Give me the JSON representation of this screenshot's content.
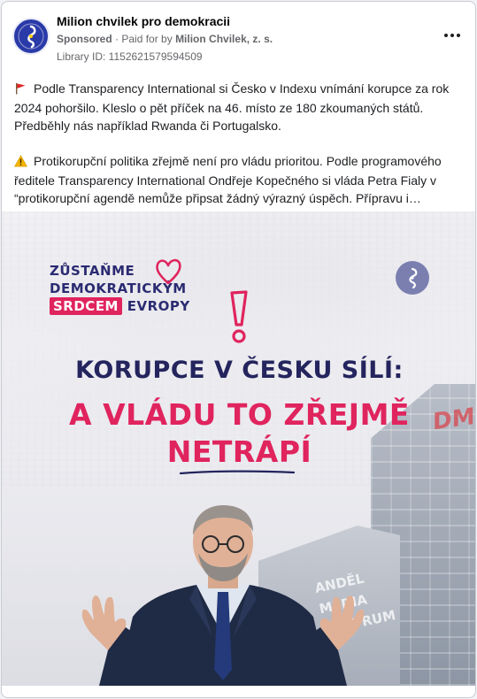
{
  "post": {
    "page_name": "Milion chvilek pro demokracii",
    "sponsored": "Sponsored",
    "paid_for_prefix": "· Paid for by",
    "payer": "Milion Chvilek, z. s.",
    "library_id": "Library ID: 1152621579594509",
    "paragraph1": "Podle Transparency International si Česko v Indexu vnímání korupce za rok 2024 pohoršilo. Kleslo o pět příček na 46. místo ze 180 zkoumaných států. Předběhly nás například Rwanda či Portugalsko.",
    "paragraph2": "Protikorupční politika zřejmě není pro vládu prioritou. Podle programového ředitele Transparency International Ondřeje Kopečného si vláda Petra Fialy v “protikorupční agendě nemůže připsat žádný výrazný úspěch. Přípravu i…",
    "icons": {
      "avatar": "milion-chvilek-logo-icon",
      "more": "more-horizontal-icon",
      "flag": "red-flag-icon",
      "warning": "warning-icon"
    }
  },
  "creative": {
    "logo_line1": "ZŮSTAŇME",
    "logo_line2": "DEMOKRATICKÝM",
    "logo_highlight": "SRDCEM",
    "logo_line3_rest": "EVROPY",
    "headline_line1": "KORUPCE V ČESKU SÍLÍ:",
    "headline_line2": "A VLÁDU TO ZŘEJMĚ",
    "headline_line3": "NETRÁPÍ",
    "building_sign": "DM",
    "mall_sign": [
      "ANDĚL",
      "MEDIA",
      "CENTRUM"
    ],
    "colors": {
      "navy": "#24245e",
      "pink": "#e0245e",
      "badge": "#7b7fb0"
    }
  }
}
